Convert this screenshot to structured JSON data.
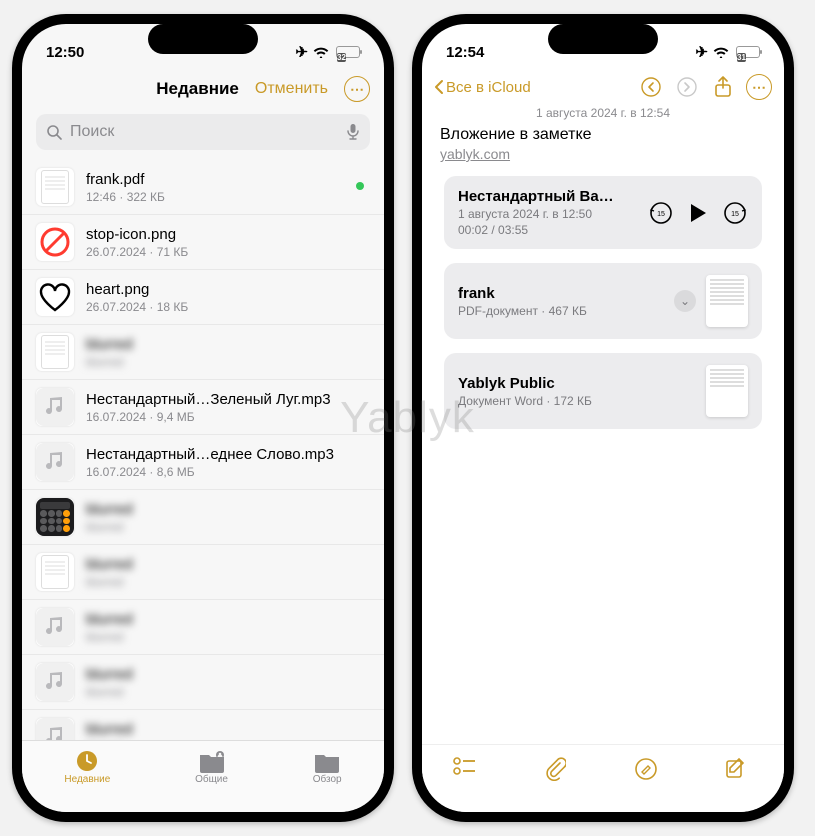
{
  "watermark": "Yablyk",
  "left": {
    "status": {
      "time": "12:50",
      "battery": "32"
    },
    "header": {
      "title": "Недавние",
      "cancel": "Отменить"
    },
    "search": {
      "placeholder": "Поиск"
    },
    "files": [
      {
        "name": "frank.pdf",
        "meta": "12:46 · 322 КБ",
        "icon": "doc",
        "fresh": true
      },
      {
        "name": "stop-icon.png",
        "meta": "26.07.2024 · 71 КБ",
        "icon": "stop"
      },
      {
        "name": "heart.png",
        "meta": "26.07.2024 · 18 КБ",
        "icon": "heart"
      },
      {
        "name": "blurred",
        "meta": "blurred",
        "icon": "doc",
        "blur": true
      },
      {
        "name": "Нестандартный…Зеленый Луг.mp3",
        "meta": "16.07.2024 · 9,4 МБ",
        "icon": "music"
      },
      {
        "name": "Нестандартный…еднее Слово.mp3",
        "meta": "16.07.2024 · 8,6 МБ",
        "icon": "music"
      },
      {
        "name": "blurred",
        "meta": "blurred",
        "icon": "calc",
        "blur": true
      },
      {
        "name": "blurred",
        "meta": "blurred",
        "icon": "doc",
        "blur": true
      },
      {
        "name": "blurred",
        "meta": "blurred",
        "icon": "music",
        "blur": true
      },
      {
        "name": "blurred",
        "meta": "blurred",
        "icon": "music",
        "blur": true
      },
      {
        "name": "blurred",
        "meta": "blurred",
        "icon": "music",
        "blur": true
      }
    ],
    "tabs": [
      {
        "label": "Недавние",
        "active": true
      },
      {
        "label": "Общие",
        "active": false
      },
      {
        "label": "Обзор",
        "active": false
      }
    ]
  },
  "right": {
    "status": {
      "time": "12:54",
      "battery": "31"
    },
    "nav": {
      "back": "Все в iCloud"
    },
    "date": "1 августа 2024 г. в 12:54",
    "note": {
      "title": "Вложение в заметке",
      "link": "yablyk.com"
    },
    "attachments": [
      {
        "type": "audio",
        "name": "Нестандартный Ва…",
        "meta": "1 августа 2024 г. в 12:50",
        "time": "00:02 / 03:55"
      },
      {
        "type": "pdf",
        "name": "frank",
        "meta": "PDF-документ · 467 КБ"
      },
      {
        "type": "word",
        "name": "Yablyk Public",
        "meta": "Документ Word · 172 КБ"
      }
    ]
  }
}
